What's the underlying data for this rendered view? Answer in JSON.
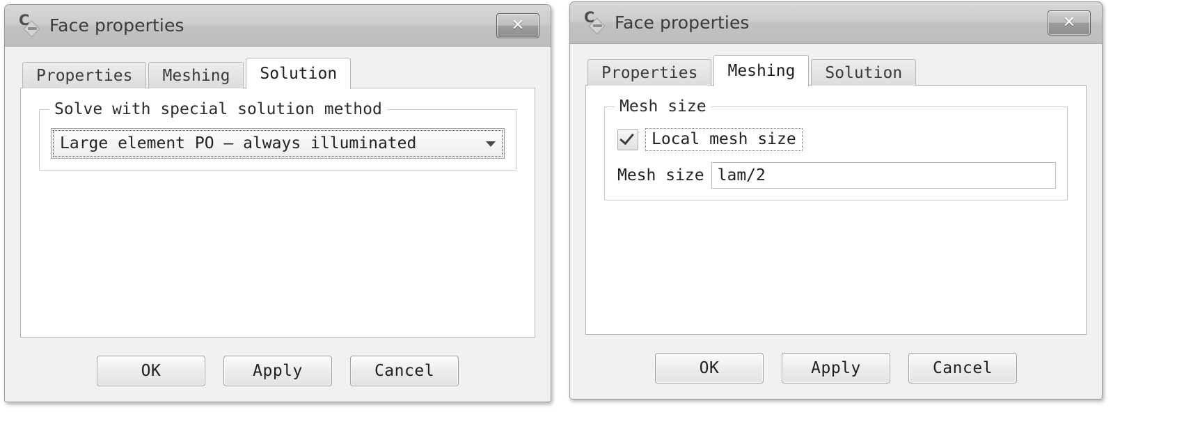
{
  "dialogs": [
    {
      "title": "Face properties",
      "icon": "app-face-icon",
      "close_label": "✕",
      "tabs": [
        {
          "label": "Properties",
          "active": false
        },
        {
          "label": "Meshing",
          "active": false
        },
        {
          "label": "Solution",
          "active": true
        }
      ],
      "solution_panel": {
        "group_title": "Solve with special solution method",
        "combo_value": "Large element PO – always illuminated",
        "combo_arrow": "chevron-down-icon"
      },
      "buttons": [
        {
          "label": "OK"
        },
        {
          "label": "Apply"
        },
        {
          "label": "Cancel"
        }
      ]
    },
    {
      "title": "Face properties",
      "icon": "app-face-icon",
      "close_label": "✕",
      "tabs": [
        {
          "label": "Properties",
          "active": false
        },
        {
          "label": "Meshing",
          "active": true
        },
        {
          "label": "Solution",
          "active": false
        }
      ],
      "meshing_panel": {
        "group_title": "Mesh size",
        "checkbox_label": "Local mesh size",
        "checkbox_checked": true,
        "field_label": "Mesh size",
        "field_value": "lam/2"
      },
      "buttons": [
        {
          "label": "OK"
        },
        {
          "label": "Apply"
        },
        {
          "label": "Cancel"
        }
      ]
    }
  ],
  "colors": {
    "window_bg": "#f0f0f0",
    "titlebar_top": "#d7d7d7",
    "titlebar_bottom": "#bdbdbd",
    "panel_bg": "#ffffff",
    "border": "#b6b6b6",
    "text": "#1f1f1f"
  }
}
